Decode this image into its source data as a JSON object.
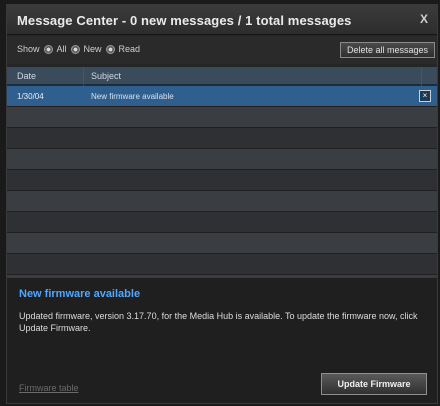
{
  "window": {
    "title": "Message Center - 0 new messages / 1 total messages",
    "close_label": "X"
  },
  "toolbar": {
    "show_label": "Show",
    "filter_all": "All",
    "filter_new": "New",
    "filter_read": "Read",
    "delete_all_label": "Delete all messages"
  },
  "table": {
    "columns": [
      "Date",
      "Subject"
    ],
    "rows": [
      {
        "date": "1/30/04",
        "subject": "New firmware available",
        "selected": true
      }
    ],
    "empty_rows": 11
  },
  "detail": {
    "title": "New firmware available",
    "body": "Updated firmware, version 3.17.70, for the Media Hub is available. To update the firmware now, click Update Firmware.",
    "firmware_table_label": "Firmware table",
    "update_button_label": "Update Firmware"
  },
  "colors": {
    "accent": "#4fa8ff",
    "selected_row": "#2f5f8f",
    "header": "#3a4b5c"
  }
}
